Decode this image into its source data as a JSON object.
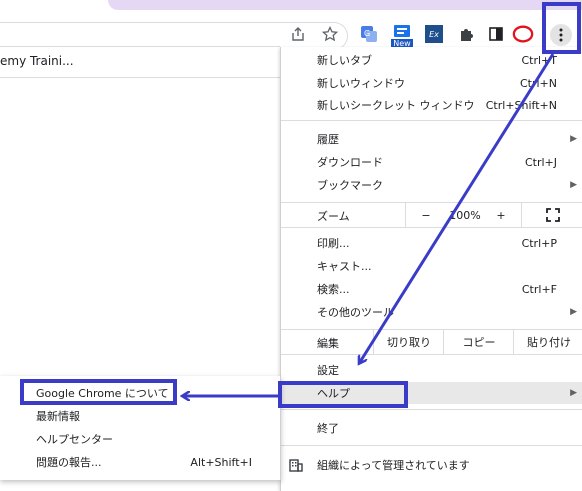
{
  "bookmarks": {
    "item_label": "emy Traini..."
  },
  "toolbar": {
    "extension_new_badge": "New",
    "extension_ex_label": "Ex"
  },
  "menu": {
    "items": [
      {
        "label": "新しいタブ",
        "shortcut": "Ctrl+T"
      },
      {
        "label": "新しいウィンドウ",
        "shortcut": "Ctrl+N"
      },
      {
        "label": "新しいシークレット ウィンドウ",
        "shortcut": "Ctrl+Shift+N"
      },
      {
        "label": "履歴",
        "shortcut": ""
      },
      {
        "label": "ダウンロード",
        "shortcut": "Ctrl+J"
      },
      {
        "label": "ブックマーク",
        "shortcut": ""
      }
    ],
    "zoom": {
      "label": "ズーム",
      "minus": "−",
      "value": "100%",
      "plus": "+"
    },
    "items2": [
      {
        "label": "印刷...",
        "shortcut": "Ctrl+P"
      },
      {
        "label": "キャスト...",
        "shortcut": ""
      },
      {
        "label": "検索...",
        "shortcut": "Ctrl+F"
      },
      {
        "label": "その他のツール",
        "shortcut": ""
      }
    ],
    "edit": {
      "label": "編集",
      "cut": "切り取り",
      "copy": "コピー",
      "paste": "貼り付け"
    },
    "settings": "設定",
    "help": "ヘルプ",
    "exit": "終了",
    "managed": "組織によって管理されています"
  },
  "help_submenu": {
    "items": [
      {
        "label": "Google Chrome について",
        "shortcut": ""
      },
      {
        "label": "最新情報",
        "shortcut": ""
      },
      {
        "label": "ヘルプセンター",
        "shortcut": ""
      },
      {
        "label": "問題の報告...",
        "shortcut": "Alt+Shift+I"
      }
    ]
  },
  "colors": {
    "annotation": "#3a3cc8",
    "highlight_circle": "#e0141e",
    "menu_hover": "#e8e8e8"
  }
}
